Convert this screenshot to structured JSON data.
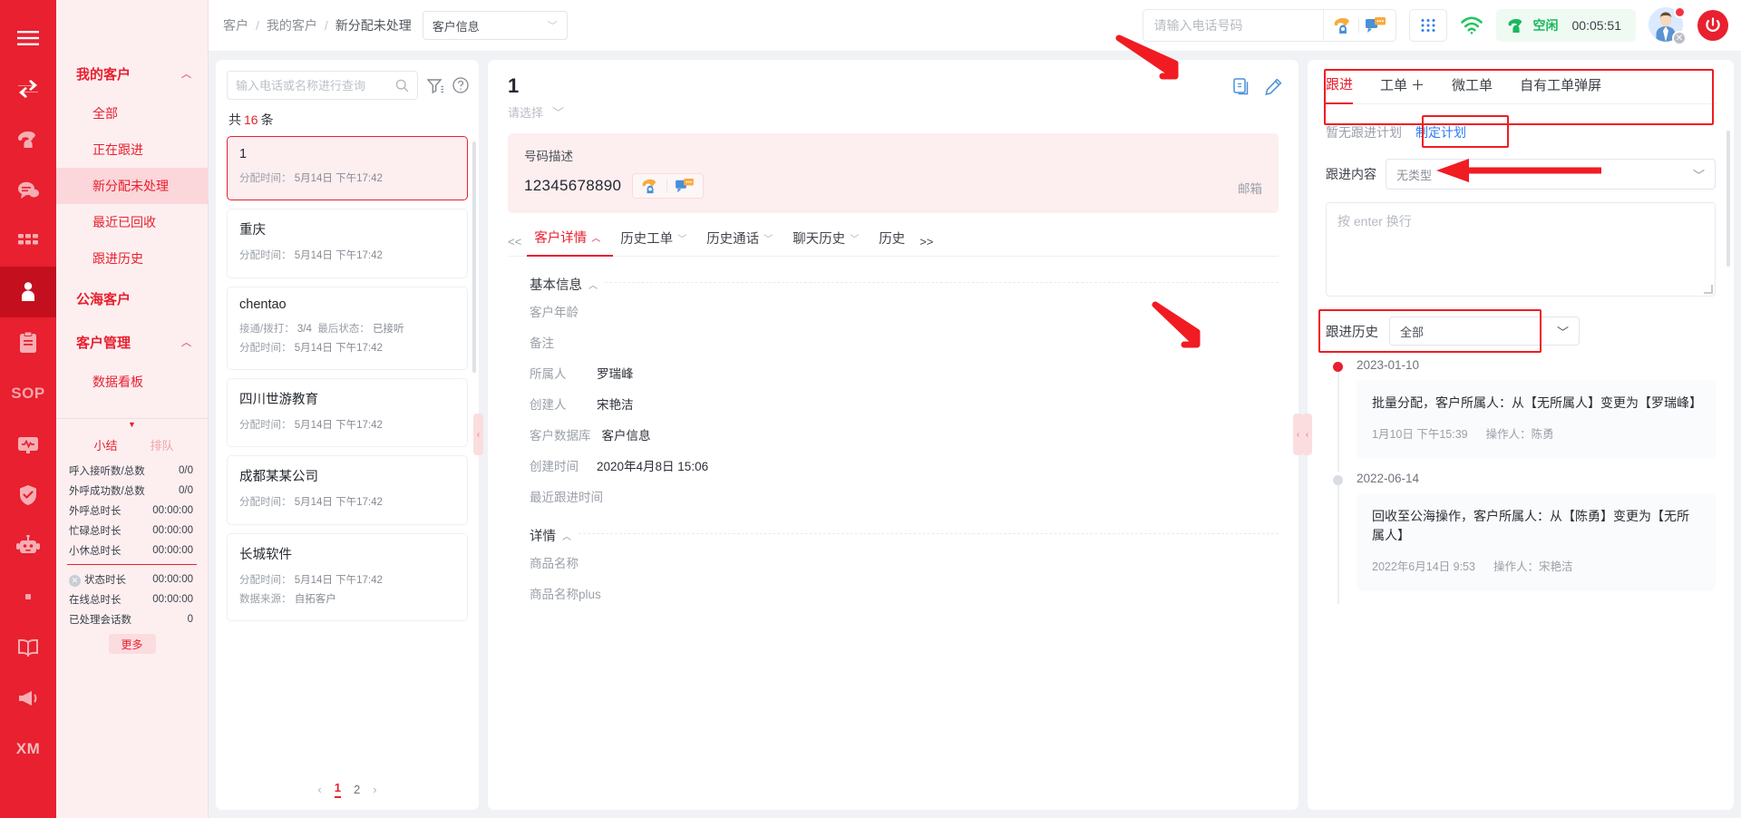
{
  "rail": {
    "items": [
      {
        "name": "menu",
        "icon": "hamburger-icon"
      },
      {
        "name": "transfer",
        "icon": "transfer-arrows-icon"
      },
      {
        "name": "phone",
        "icon": "phone-icon"
      },
      {
        "name": "chat",
        "icon": "chat-bubble-icon"
      },
      {
        "name": "apps",
        "icon": "grid-icon"
      },
      {
        "name": "customer",
        "icon": "user-icon",
        "active": true
      },
      {
        "name": "clipboard",
        "icon": "clipboard-icon"
      },
      {
        "name": "sop",
        "icon": "sop-text",
        "text": "SOP"
      },
      {
        "name": "monitor",
        "icon": "monitor-icon"
      },
      {
        "name": "shield",
        "icon": "shield-check-icon"
      },
      {
        "name": "robot",
        "icon": "robot-icon"
      },
      {
        "name": "dot",
        "icon": "dot-icon"
      },
      {
        "name": "book",
        "icon": "book-icon"
      },
      {
        "name": "megaphone",
        "icon": "megaphone-icon"
      },
      {
        "name": "xm",
        "icon": "xm-text",
        "text": "XM"
      }
    ]
  },
  "sidebar": {
    "groups": [
      {
        "label": "我的客户",
        "items": [
          {
            "label": "全部",
            "active": false
          },
          {
            "label": "正在跟进",
            "active": false
          },
          {
            "label": "新分配未处理",
            "active": true
          },
          {
            "label": "最近已回收",
            "active": false
          },
          {
            "label": "跟进历史",
            "active": false
          }
        ]
      }
    ],
    "public_sea_label": "公海客户",
    "manage_label": "客户管理",
    "manage_items": [
      {
        "label": "数据看板"
      }
    ],
    "stats": {
      "tabs": [
        {
          "label": "小结",
          "active": true
        },
        {
          "label": "排队",
          "active": false
        }
      ],
      "rows": [
        {
          "label": "呼入接听数/总数",
          "value": "0/0"
        },
        {
          "label": "外呼成功数/总数",
          "value": "0/0"
        },
        {
          "label": "外呼总时长",
          "value": "00:00:00"
        },
        {
          "label": "忙碌总时长",
          "value": "00:00:00"
        },
        {
          "label": "小休总时长",
          "value": "00:00:00"
        }
      ],
      "rows2": [
        {
          "label": "状态时长",
          "value": "00:00:00",
          "icon": "x-circle-icon"
        },
        {
          "label": "在线总时长",
          "value": "00:00:00"
        },
        {
          "label": "已处理会话数",
          "value": "0"
        }
      ],
      "more_label": "更多"
    }
  },
  "topbar": {
    "breadcrumb": [
      "客户",
      "我的客户",
      "新分配未处理"
    ],
    "database_select": "客户信息",
    "phone_placeholder": "请输入电话号码",
    "phone_value": "",
    "status_label": "空闲",
    "timer": "00:05:51"
  },
  "list": {
    "search_placeholder": "输入电话或名称进行查询",
    "search_value": "",
    "count_prefix": "共",
    "count": "16",
    "count_suffix": "条",
    "items": [
      {
        "title": "1",
        "alloc_label": "分配时间：",
        "alloc_time": "5月14日 下午17:42",
        "selected": true
      },
      {
        "title": "重庆",
        "alloc_label": "分配时间：",
        "alloc_time": "5月14日 下午17:42",
        "selected": false
      },
      {
        "title": "chentao",
        "connect_label": "接通/拨打：",
        "connect_value": "3/4",
        "status_label": "最后状态：",
        "status_value": "已接听",
        "alloc_label": "分配时间：",
        "alloc_time": "5月14日 下午17:42",
        "selected": false
      },
      {
        "title": "四川世游教育",
        "alloc_label": "分配时间：",
        "alloc_time": "5月14日 下午17:42",
        "selected": false
      },
      {
        "title": "成都某某公司",
        "alloc_label": "分配时间：",
        "alloc_time": "5月14日 下午17:42",
        "selected": false
      },
      {
        "title": "长城软件",
        "alloc_label": "分配时间：",
        "alloc_time": "5月14日 下午17:42",
        "source_label": "数据来源：",
        "source_value": "自拓客户",
        "selected": false
      }
    ],
    "pager": {
      "prev": "‹",
      "pages": [
        "1",
        "2"
      ],
      "current": "1",
      "next": "›"
    }
  },
  "detail": {
    "title": "1",
    "select_placeholder": "请选择",
    "number_label": "号码描述",
    "number_value": "12345678890",
    "email_label": "邮箱",
    "tabs_left_arrow": "<<",
    "tabs_right_arrow": ">>",
    "tabs": [
      {
        "label": "客户详情",
        "active": true,
        "arrow": "︿"
      },
      {
        "label": "历史工单",
        "active": false,
        "arrow": "﹀"
      },
      {
        "label": "历史通话",
        "active": false,
        "arrow": "﹀"
      },
      {
        "label": "聊天历史",
        "active": false,
        "arrow": "﹀"
      },
      {
        "label": "历史",
        "active": false,
        "arrow": ""
      }
    ],
    "sections": [
      {
        "title": "基本信息",
        "arrow": "︿",
        "fields": [
          {
            "key": "客户年龄",
            "value": ""
          },
          {
            "key": "备注",
            "value": ""
          },
          {
            "key": "所属人",
            "value": "罗瑞峰"
          },
          {
            "key": "创建人",
            "value": "宋艳洁"
          },
          {
            "key": "客户数据库",
            "value": "客户信息"
          },
          {
            "key": "创建时间",
            "value": "2020年4月8日 15:06"
          },
          {
            "key": "最近跟进时间",
            "value": ""
          }
        ]
      },
      {
        "title": "详情",
        "arrow": "︿",
        "fields": [
          {
            "key": "商品名称",
            "value": ""
          },
          {
            "key": "商品名称plus",
            "value": ""
          }
        ]
      }
    ]
  },
  "follow": {
    "tabs": [
      {
        "label": "跟进",
        "active": true
      },
      {
        "label": "工单",
        "active": false,
        "plus": "＋"
      },
      {
        "label": "微工单",
        "active": false
      },
      {
        "label": "自有工单弹屏",
        "active": false
      }
    ],
    "no_plan_text": "暂无跟进计划",
    "make_plan_label": "制定计划",
    "content_label": "跟进内容",
    "content_type": "无类型",
    "textarea_placeholder": "按 enter 换行",
    "textarea_value": "",
    "history_label": "跟进历史",
    "history_filter": "全部",
    "timeline": [
      {
        "date": "2023-01-10",
        "active": true,
        "text": "批量分配，客户所属人：从【无所属人】变更为【罗瑞峰】",
        "time": "1月10日 下午15:39",
        "operator_label": "操作人：",
        "operator": "陈勇"
      },
      {
        "date": "2022-06-14",
        "active": false,
        "text": "回收至公海操作，客户所属人：从【陈勇】变更为【无所属人】",
        "time": "2022年6月14日 9:53",
        "operator_label": "操作人：",
        "operator": "宋艳洁"
      }
    ]
  },
  "colors": {
    "brand_red": "#e8202f",
    "annotation_red": "#f01c22",
    "link_blue": "#2f7bf5",
    "status_green": "#18b95c"
  }
}
